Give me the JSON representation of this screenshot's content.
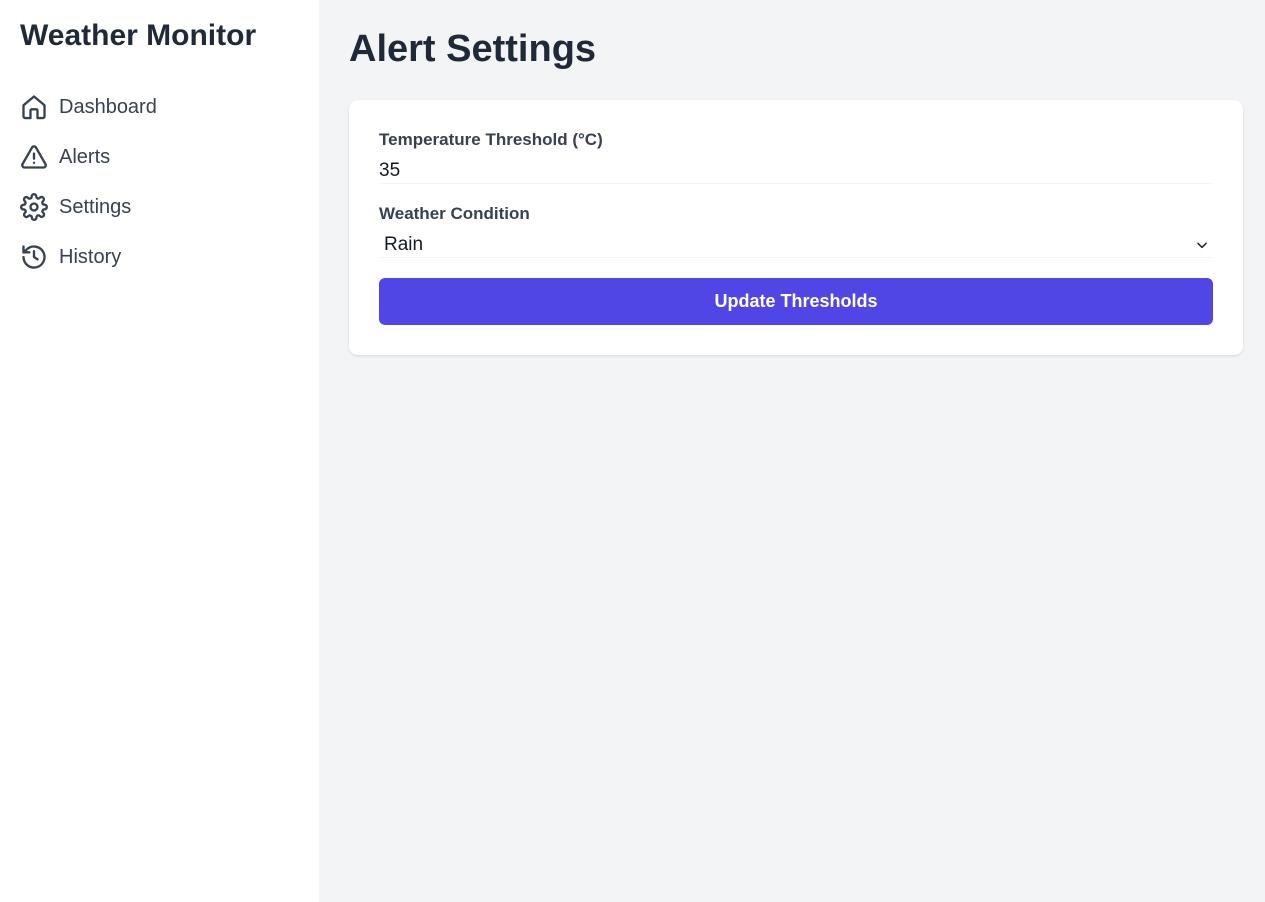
{
  "sidebar": {
    "title": "Weather Monitor",
    "items": [
      {
        "label": "Dashboard",
        "icon": "home-icon"
      },
      {
        "label": "Alerts",
        "icon": "warning-icon"
      },
      {
        "label": "Settings",
        "icon": "gear-icon"
      },
      {
        "label": "History",
        "icon": "history-icon"
      }
    ]
  },
  "main": {
    "title": "Alert Settings",
    "form": {
      "temperature_label": "Temperature Threshold (°C)",
      "temperature_value": "35",
      "condition_label": "Weather Condition",
      "condition_value": "Rain",
      "submit_label": "Update Thresholds"
    }
  },
  "colors": {
    "accent": "#4f46e5",
    "main_background": "#f3f4f6",
    "sidebar_background": "#ffffff",
    "text_primary": "#1f2937"
  }
}
